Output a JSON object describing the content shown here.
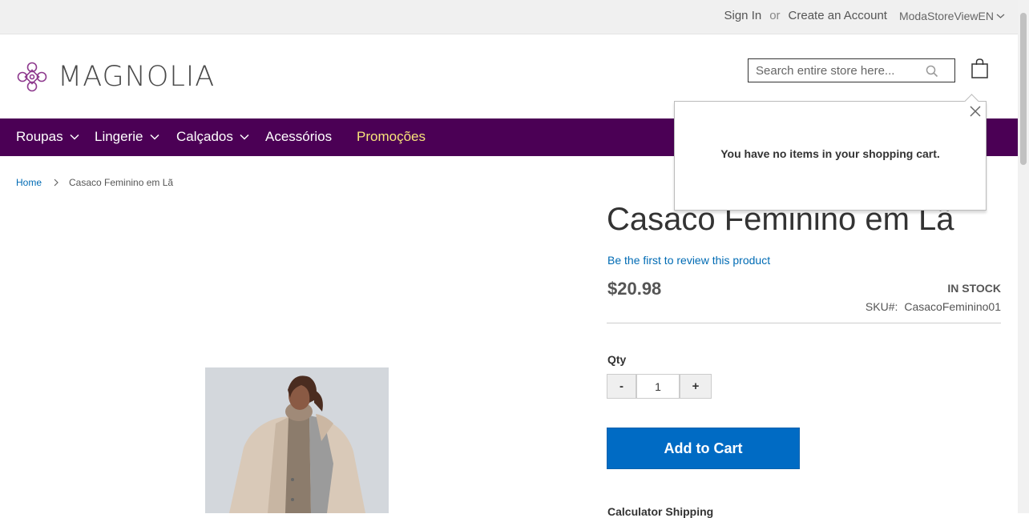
{
  "topbar": {
    "sign_in": "Sign In",
    "or": "or",
    "create_account": "Create an Account",
    "store_view": "ModaStoreViewEN"
  },
  "header": {
    "logo_text": "MAGNOLIA",
    "search_placeholder": "Search entire store here...",
    "cart_icon": "shopping-bag-icon"
  },
  "nav": {
    "items": [
      {
        "label": "Roupas",
        "has_dropdown": true
      },
      {
        "label": "Lingerie",
        "has_dropdown": true
      },
      {
        "label": "Calçados",
        "has_dropdown": true
      },
      {
        "label": "Acessórios",
        "has_dropdown": false
      },
      {
        "label": "Promoções",
        "has_dropdown": false
      }
    ]
  },
  "breadcrumb": {
    "home": "Home",
    "current": "Casaco Feminino em Lã"
  },
  "product": {
    "title": "Casaco Feminino em Lã",
    "review_link": "Be the first to review this product",
    "price": "$20.98",
    "stock": "IN STOCK",
    "sku_label": "SKU#:",
    "sku": "CasacoFeminino01",
    "qty_label": "Qty",
    "qty_value": "1",
    "qty_minus": "-",
    "qty_plus": "+",
    "add_to_cart": "Add to Cart",
    "shipping_label": "Calculator Shipping"
  },
  "minicart": {
    "empty_message": "You have no items in your shopping cart."
  },
  "colors": {
    "nav_bg": "#4b0055",
    "promo": "#f7e37a",
    "link": "#006bb4",
    "button": "#006bc4"
  }
}
